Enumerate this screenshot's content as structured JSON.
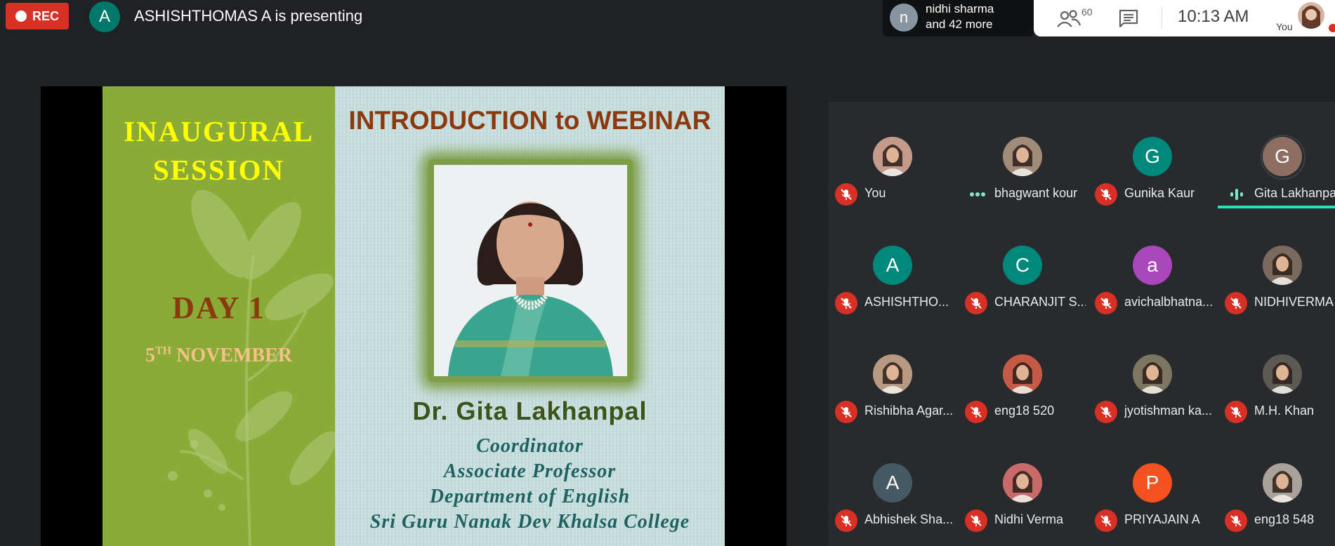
{
  "recording": {
    "label": "REC"
  },
  "presenter": {
    "initial": "A",
    "text": "ASHISHTHOMAS A is presenting"
  },
  "people_summary": {
    "initial": "n",
    "line1": "nidhi sharma",
    "line2": "and 42 more"
  },
  "controls": {
    "participant_count": "60",
    "time": "10:13  AM",
    "you_label": "You"
  },
  "slide": {
    "left_line1": "INAUGURAL",
    "left_line2": "SESSION",
    "day": "DAY 1",
    "date_num": "5",
    "date_sup": "TH",
    "date_rest": " NOVEMBER",
    "title": "INTRODUCTION to WEBINAR",
    "speaker": "Dr. Gita Lakhanpal",
    "designations": [
      "Coordinator",
      "Associate Professor",
      "Department of English",
      "Sri Guru Nanak Dev Khalsa College"
    ]
  },
  "participants": [
    {
      "name": "You",
      "initial": "",
      "color": "#c49a8a",
      "photo": true,
      "status": "muted"
    },
    {
      "name": "bhagwant kour",
      "initial": "",
      "color": "#a08a78",
      "photo": true,
      "status": "dots"
    },
    {
      "name": "Gunika Kaur",
      "initial": "G",
      "color": "#00897b",
      "photo": false,
      "status": "muted"
    },
    {
      "name": "Gita Lakhanpal",
      "initial": "G",
      "color": "#8d6e63",
      "photo": false,
      "status": "speaking"
    },
    {
      "name": "ASHISHTHO...",
      "initial": "A",
      "color": "#00897b",
      "photo": false,
      "status": "muted"
    },
    {
      "name": "CHARANJIT S...",
      "initial": "C",
      "color": "#00897b",
      "photo": false,
      "status": "muted"
    },
    {
      "name": "avichalbhatna...",
      "initial": "a",
      "color": "#ab47bc",
      "photo": false,
      "status": "muted"
    },
    {
      "name": "NIDHIVERMA A",
      "initial": "",
      "color": "#7a6a5e",
      "photo": true,
      "status": "muted"
    },
    {
      "name": "Rishibha Agar...",
      "initial": "",
      "color": "#b89a84",
      "photo": true,
      "status": "muted"
    },
    {
      "name": "eng18 520",
      "initial": "",
      "color": "#c75a44",
      "photo": true,
      "status": "muted"
    },
    {
      "name": "jyotishman ka...",
      "initial": "",
      "color": "#7c7660",
      "photo": true,
      "status": "muted"
    },
    {
      "name": "M.H. Khan",
      "initial": "",
      "color": "#5c5a52",
      "photo": true,
      "status": "muted"
    },
    {
      "name": "Abhishek Sha...",
      "initial": "A",
      "color": "#455a64",
      "photo": false,
      "status": "muted"
    },
    {
      "name": "Nidhi Verma",
      "initial": "",
      "color": "#c86a6a",
      "photo": true,
      "status": "muted"
    },
    {
      "name": "PRIYAJAIN A",
      "initial": "P",
      "color": "#f4511e",
      "photo": false,
      "status": "muted"
    },
    {
      "name": "eng18 548",
      "initial": "",
      "color": "#a8a29a",
      "photo": true,
      "status": "muted"
    }
  ]
}
